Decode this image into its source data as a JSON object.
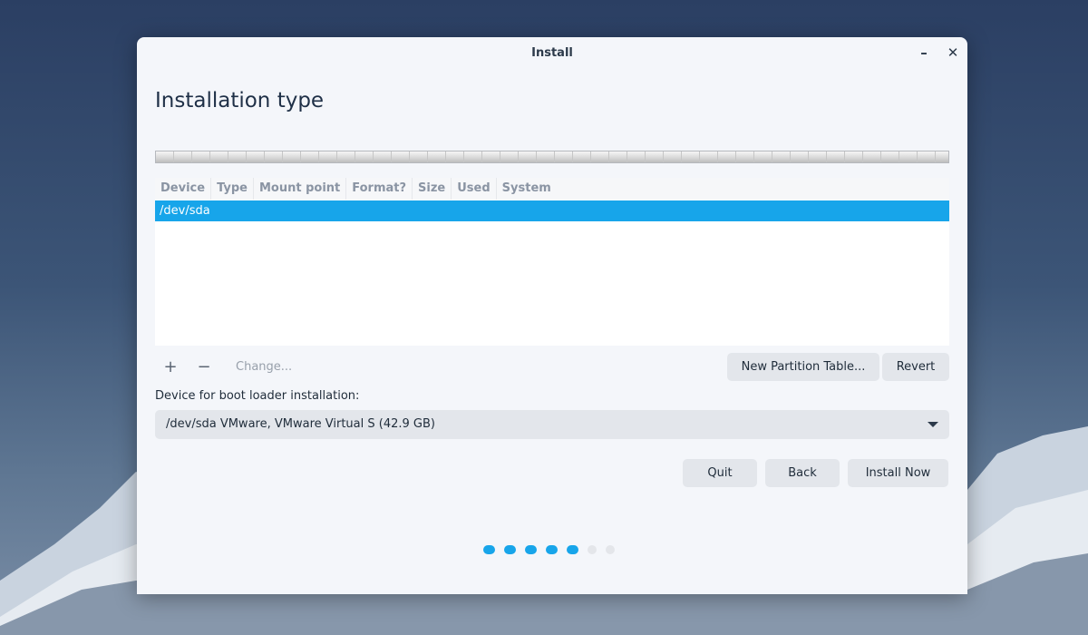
{
  "window": {
    "title": "Install",
    "minimize_icon": "minimize-icon",
    "close_icon": "close-icon"
  },
  "page": {
    "heading": "Installation type"
  },
  "table": {
    "columns": [
      "Device",
      "Type",
      "Mount point",
      "Format?",
      "Size",
      "Used",
      "System"
    ],
    "rows": [
      {
        "device": "/dev/sda"
      }
    ]
  },
  "tools": {
    "add": "+",
    "remove": "−",
    "change": "Change...",
    "new_partition_table": "New Partition Table...",
    "revert": "Revert"
  },
  "bootloader": {
    "label": "Device for boot loader installation:",
    "value": "/dev/sda VMware, VMware Virtual S (42.9 GB)"
  },
  "actions": {
    "quit": "Quit",
    "back": "Back",
    "install_now": "Install Now"
  },
  "progress": {
    "total_steps": 7,
    "completed_steps": 5,
    "active_color": "#17a5ea",
    "inactive_color": "#e4e6ea"
  }
}
